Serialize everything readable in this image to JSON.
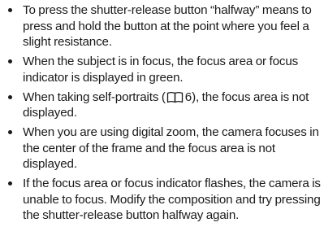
{
  "bullets": [
    {
      "text": "To press the shutter-release button “halfway” means to press and hold the button at the point where you feel a slight resistance."
    },
    {
      "text": "When the subject is in focus, the focus area or focus indicator is displayed in green."
    },
    {
      "text_before": "When taking self-portraits (",
      "icon": "reference-book-icon",
      "page_ref": "6",
      "text_after": "), the focus area is not displayed."
    },
    {
      "text": "When you are using digital zoom, the camera focuses in the center of the frame and the focus area is not displayed."
    },
    {
      "text": "If the focus area or focus indicator flashes, the camera is unable to focus. Modify the composition and try pressing the shutter-release button halfway again."
    }
  ]
}
